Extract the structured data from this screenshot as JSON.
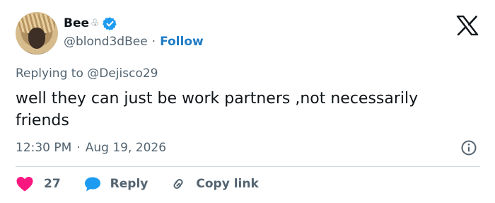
{
  "author": {
    "display_name": "Bee",
    "name_emoji": "♧",
    "handle": "@blond3dBee",
    "separator": "·",
    "follow_label": "Follow"
  },
  "reply_to": "Replying to @Dejisco29",
  "tweet_text": "well they can just be work partners ,not necessarily friends",
  "meta": {
    "time": "12:30 PM",
    "separator": "·",
    "date": "Aug 19, 2026"
  },
  "actions": {
    "like_count": "27",
    "reply_label": "Reply",
    "copy_link_label": "Copy link"
  },
  "colors": {
    "verified": "#1d9bf0",
    "follow": "#1d7bc4",
    "like": "#f91880",
    "reply": "#1d9bf0",
    "secondary_text": "#536471"
  }
}
